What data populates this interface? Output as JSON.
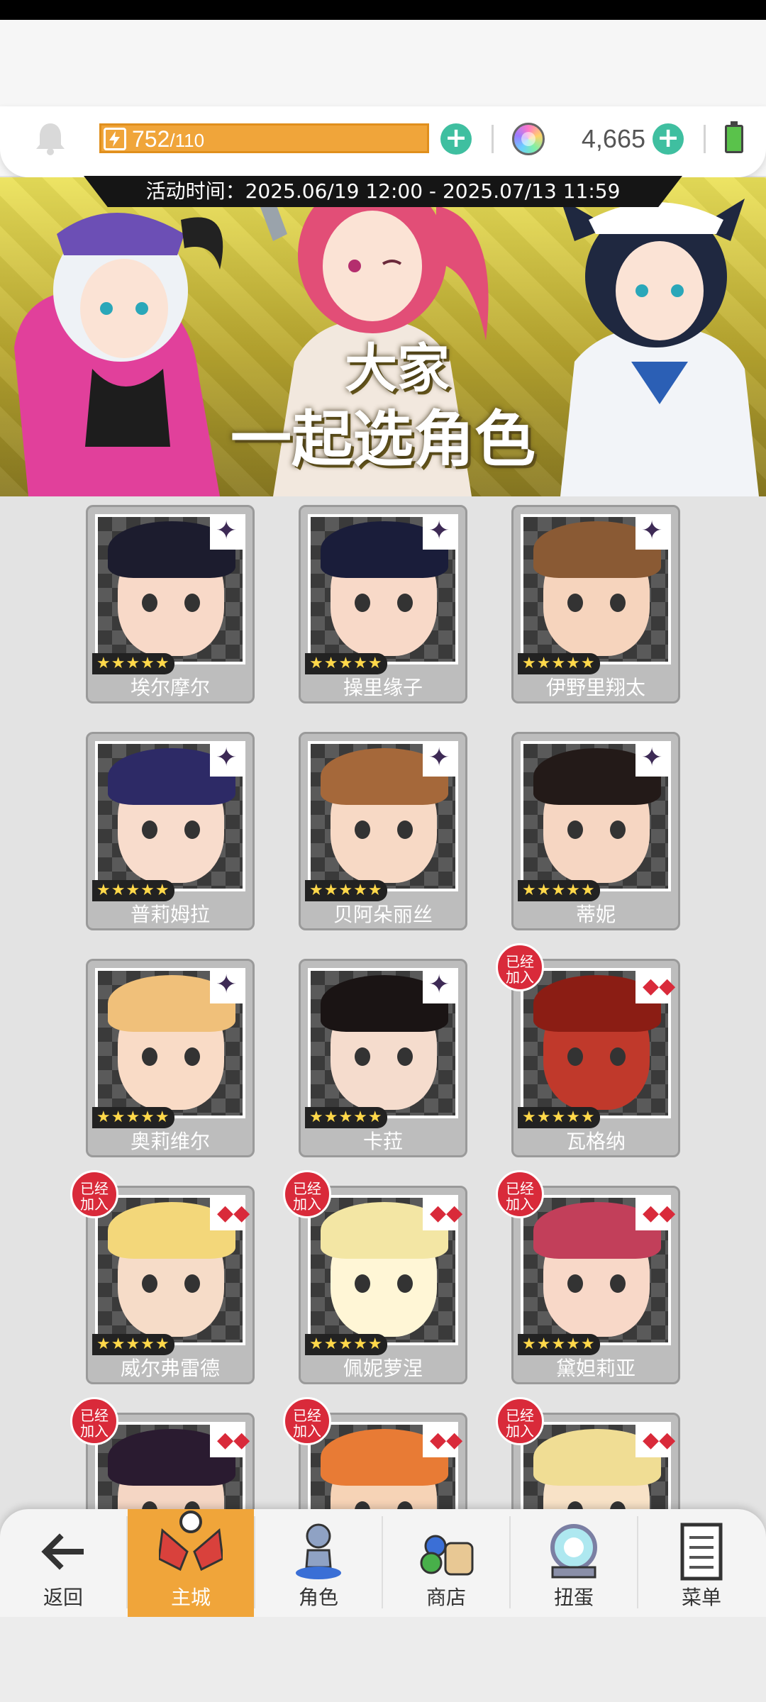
{
  "header": {
    "energy_current": "752",
    "energy_max": "/110",
    "gems": "4,665",
    "plus_symbol": "+",
    "accent_color": "#f0a53a",
    "plus_color": "#3fbfa0"
  },
  "banner": {
    "event_time": "活动时间：2025.06/19 12:00 - 2025.07/13 11:59",
    "title_line1": "大家",
    "title_line2": "一起选角色"
  },
  "characters": [
    {
      "name": "埃尔摩尔",
      "stars": "★★★★★",
      "joined": false,
      "badge": "✦"
    },
    {
      "name": "操里缘子",
      "stars": "★★★★★",
      "joined": false,
      "badge": "✦"
    },
    {
      "name": "伊野里翔太",
      "stars": "★★★★★",
      "joined": false,
      "badge": "✦"
    },
    {
      "name": "普莉姆拉",
      "stars": "★★★★★",
      "joined": false,
      "badge": "✦"
    },
    {
      "name": "贝阿朵丽丝",
      "stars": "★★★★★",
      "joined": false,
      "badge": "✦"
    },
    {
      "name": "蒂妮",
      "stars": "★★★★★",
      "joined": false,
      "badge": "✦"
    },
    {
      "name": "奥莉维尔",
      "stars": "★★★★★",
      "joined": false,
      "badge": "✦"
    },
    {
      "name": "卡菈",
      "stars": "★★★★★",
      "joined": false,
      "badge": "✦"
    },
    {
      "name": "瓦格纳",
      "stars": "★★★★★",
      "joined": true,
      "badge": "◆◆"
    },
    {
      "name": "威尔弗雷德",
      "stars": "★★★★★",
      "joined": true,
      "badge": "◆◆"
    },
    {
      "name": "佩妮萝涅",
      "stars": "★★★★★",
      "joined": true,
      "badge": "◆◆"
    },
    {
      "name": "黛妲莉亚",
      "stars": "★★★★★",
      "joined": true,
      "badge": "◆◆"
    },
    {
      "name": "",
      "stars": "",
      "joined": true,
      "badge": "◆◆"
    },
    {
      "name": "",
      "stars": "",
      "joined": true,
      "badge": "◆◆"
    },
    {
      "name": "",
      "stars": "",
      "joined": true,
      "badge": "◆◆"
    }
  ],
  "joined_label_1": "已经",
  "joined_label_2": "加入",
  "nav": {
    "back": "返回",
    "main_city": "主城",
    "characters": "角色",
    "shop": "商店",
    "gacha": "扭蛋",
    "menu": "菜单"
  }
}
